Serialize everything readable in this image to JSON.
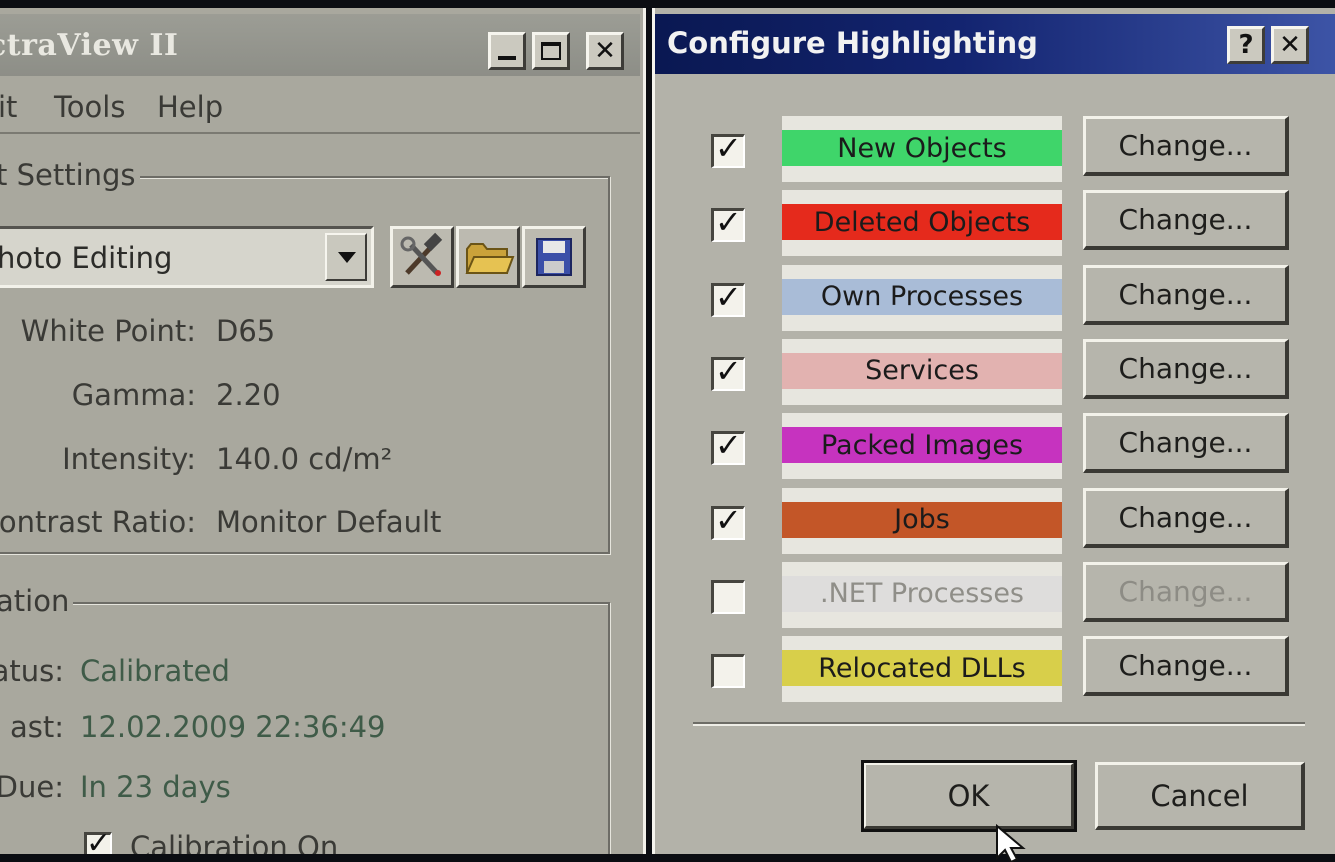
{
  "left_window": {
    "title": "ctraView II",
    "menu": [
      "it",
      "Tools",
      "Help"
    ],
    "settings_group_label": "t Settings",
    "preset_value": "hoto Editing",
    "rows": [
      {
        "label": "White Point:",
        "value": "D65"
      },
      {
        "label": "Gamma:",
        "value": "2.20"
      },
      {
        "label": "Intensity:",
        "value": "140.0 cd/m²"
      },
      {
        "label": "ontrast Ratio:",
        "value": "Monitor Default"
      }
    ],
    "calibration_group_label": "ation",
    "calibration": [
      {
        "label": "atus:",
        "value": "Calibrated"
      },
      {
        "label": "ast:",
        "value": "12.02.2009 22:36:49"
      },
      {
        "label": "Due:",
        "value": "In 23 days"
      }
    ],
    "calibration_on_label": "Calibration On"
  },
  "dialog": {
    "title": "Configure Highlighting",
    "help_label": "?",
    "close_label": "✕",
    "change_label": "Change...",
    "items": [
      {
        "label": "New Objects",
        "checked": true,
        "color": "#3fd56a",
        "enabled": true
      },
      {
        "label": "Deleted Objects",
        "checked": true,
        "color": "#e52a1c",
        "enabled": true
      },
      {
        "label": "Own Processes",
        "checked": true,
        "color": "#a9bcd7",
        "enabled": true
      },
      {
        "label": "Services",
        "checked": true,
        "color": "#e2b2b0",
        "enabled": true
      },
      {
        "label": "Packed Images",
        "checked": true,
        "color": "#c633bf",
        "enabled": true
      },
      {
        "label": "Jobs",
        "checked": true,
        "color": "#c35628",
        "enabled": true
      },
      {
        "label": ".NET Processes",
        "checked": false,
        "color": "#dedddc",
        "enabled": false
      },
      {
        "label": "Relocated DLLs",
        "checked": false,
        "color": "#d8cf4a",
        "enabled": true
      }
    ],
    "ok_label": "OK",
    "cancel_label": "Cancel"
  }
}
